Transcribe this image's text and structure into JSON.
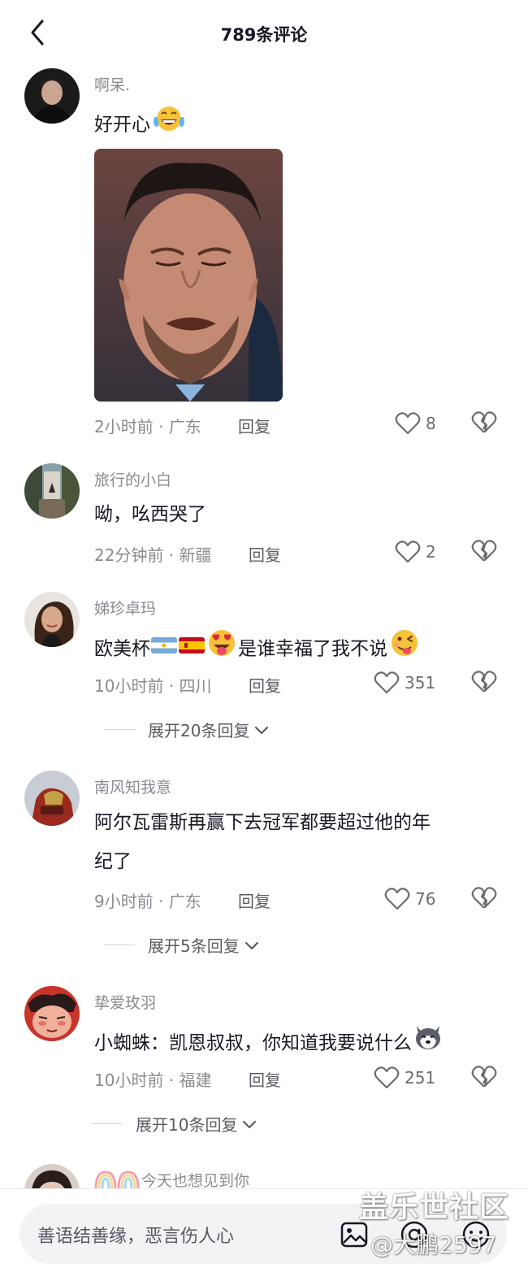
{
  "header": {
    "title": "789条评论",
    "back_icon": "chevron-left-icon"
  },
  "comments": [
    {
      "username": "啊呆.",
      "text": "好开心",
      "emoji": "joy-tears-emoji",
      "has_image": true,
      "image_desc": "crying-man-photo",
      "time": "2小时前",
      "location": "广东",
      "reply_label": "回复",
      "likes": "8"
    },
    {
      "username": "旅行的小白",
      "text": "呦，吆西哭了",
      "time": "22分钟前",
      "location": "新疆",
      "reply_label": "回复",
      "likes": "2"
    },
    {
      "username": "娣珍卓玛",
      "text_before": "欧美杯",
      "text_after": "是谁幸福了我不说",
      "emojis": [
        "argentina-flag",
        "spain-flag",
        "heart-eyes-tongue-emoji",
        "winking-tongue-emoji"
      ],
      "time": "10小时前",
      "location": "四川",
      "reply_label": "回复",
      "likes": "351",
      "expand_label": "展开20条回复"
    },
    {
      "username": "南风知我意",
      "text_line1": "阿尔瓦雷斯再赢下去冠军都要超过他的年",
      "text_line2": "纪了",
      "time": "9小时前",
      "location": "广东",
      "reply_label": "回复",
      "likes": "76",
      "expand_label": "展开5条回复"
    },
    {
      "username": "挚爱玫羽",
      "text": "小蜘蛛：凯恩叔叔，你知道我要说什么",
      "emoji": "husky-dog-emoji",
      "time": "10小时前",
      "location": "福建",
      "reply_label": "回复",
      "likes": "251",
      "expand_label": "展开10条回复"
    },
    {
      "username": "今天也想见到你",
      "name_prefix_emoji": "rainbow-emoji"
    }
  ],
  "bottom_bar": {
    "placeholder": "善语结善缘，恶言伤人心",
    "icons": [
      "image-icon",
      "at-sign-icon",
      "emoji-face-icon"
    ]
  },
  "watermark": {
    "line1": "盖乐世社区",
    "line2": "@大鹏2597"
  },
  "colors": {
    "text_primary": "#161823",
    "text_secondary": "#8a8b91",
    "background": "#ffffff",
    "input_bg": "#f3f3f5"
  }
}
